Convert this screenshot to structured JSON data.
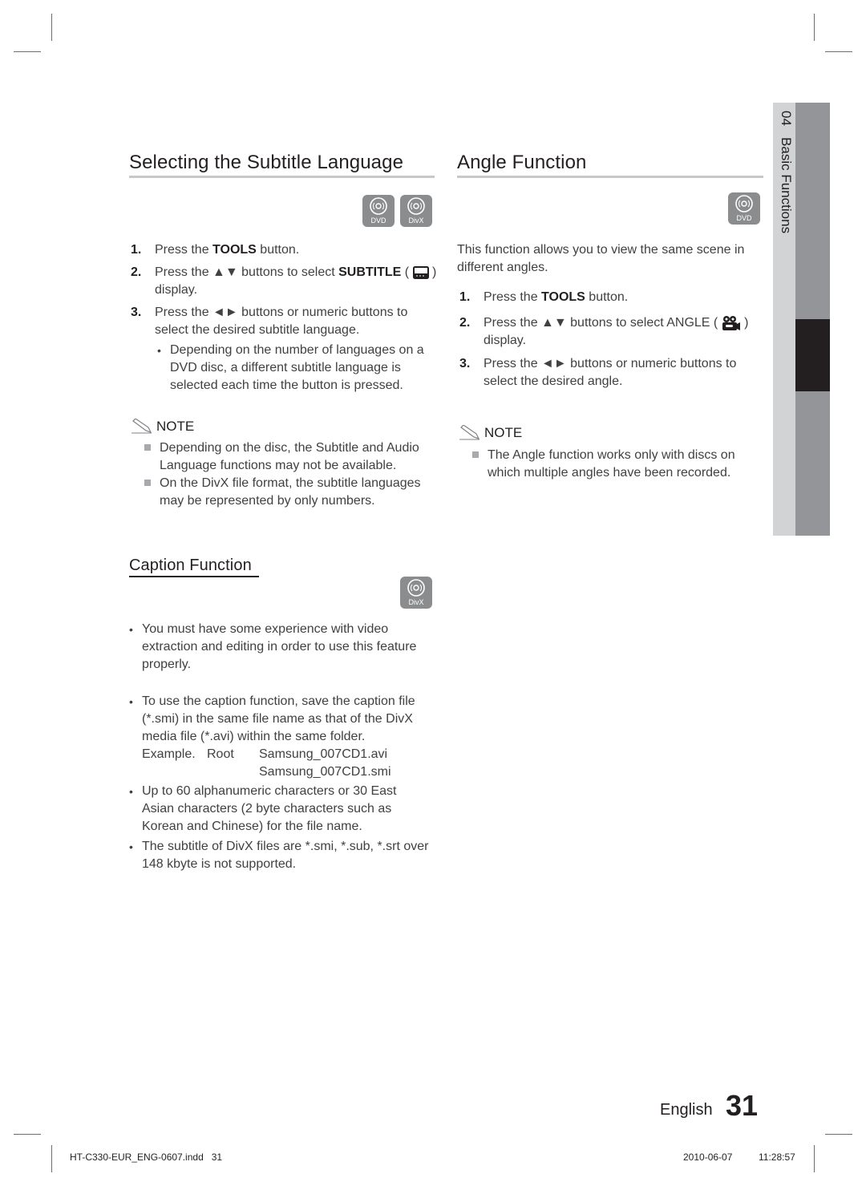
{
  "sidebar": {
    "chapter_number": "04",
    "chapter_title": "Basic Functions"
  },
  "subtitle_section": {
    "title": "Selecting the Subtitle Language",
    "badges": [
      "DVD",
      "DivX"
    ],
    "steps": [
      {
        "num": "1.",
        "pre": "Press the ",
        "keyword": "TOOLS",
        "post": " button."
      },
      {
        "num": "2.",
        "pre": "Press the ▲▼ buttons to select ",
        "keyword": "SUBTITLE",
        "icon_open": " ( ",
        "icon": "subtitle-icon",
        "icon_close": " )",
        "post": "display."
      },
      {
        "num": "3.",
        "text": "Press the ◄► buttons or numeric buttons to select the desired subtitle language."
      }
    ],
    "sub_bullet": "Depending on the number of languages on a DVD disc, a different subtitle language is selected each time the button is pressed.",
    "note_label": "NOTE",
    "notes": [
      "Depending on the disc, the Subtitle and Audio Language functions may not be available.",
      "On the DivX file format, the subtitle languages may be represented by only numbers."
    ]
  },
  "angle_section": {
    "title": "Angle Function",
    "badges": [
      "DVD"
    ],
    "intro": "This function allows you to view the same scene in different angles.",
    "steps": [
      {
        "num": "1.",
        "pre": "Press the ",
        "keyword": "TOOLS",
        "post": " button."
      },
      {
        "num": "2.",
        "pre": "Press the ▲▼ buttons to select ANGLE ( ",
        "icon": "camera-icon",
        "icon_close": " )",
        "post": "display."
      },
      {
        "num": "3.",
        "text": "Press the ◄► buttons or numeric buttons to select the desired angle."
      }
    ],
    "note_label": "NOTE",
    "notes": [
      "The Angle function works only with discs on which multiple angles have been recorded."
    ]
  },
  "caption_section": {
    "title": "Caption Function",
    "badges": [
      "DivX"
    ],
    "bullets": [
      "You must have some experience with video extraction and editing in order to use this feature properly.",
      "To use the caption function, save the caption file (*.smi) in the same file name as that of the DivX media file (*.avi) within the same folder.",
      "Up to 60 alphanumeric characters or 30 East Asian characters (2 byte characters such as Korean and Chinese) for the file name.",
      "The subtitle of DivX files are *.smi, *.sub, *.srt over 148 kbyte is not supported."
    ],
    "example": {
      "label": "Example.",
      "folder": "Root",
      "files": [
        "Samsung_007CD1.avi",
        "Samsung_007CD1.smi"
      ]
    }
  },
  "page_footer": {
    "language": "English",
    "page_number": "31"
  },
  "print_slug": {
    "file": "HT-C330-EUR_ENG-0607.indd   31",
    "date": "2010-06-07",
    "time": "11:28:57"
  },
  "colors": {
    "badge_gray": "#8a8c8e",
    "rule_gray": "#c7c8ca",
    "side_light": "#d1d3d4",
    "side_dark": "#939598",
    "side_active": "#231f20"
  }
}
